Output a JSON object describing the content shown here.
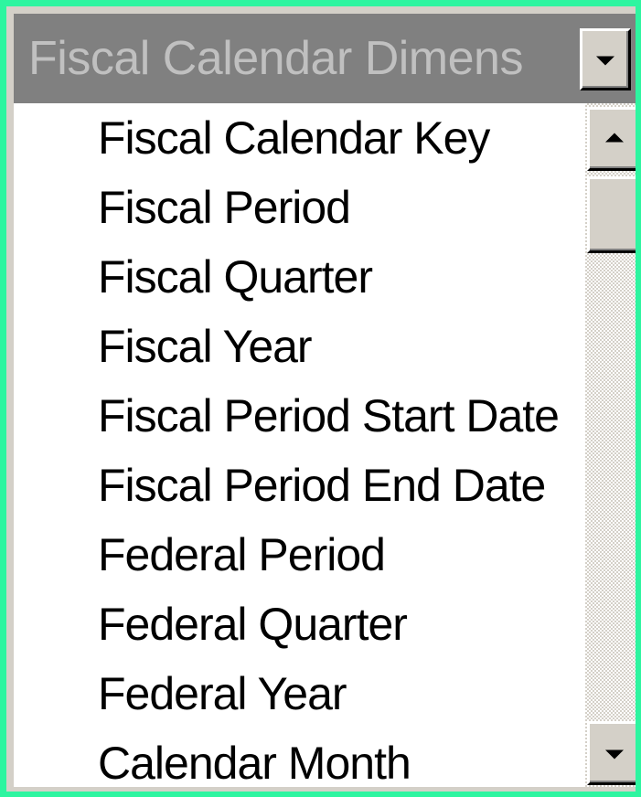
{
  "header": {
    "title": "Fiscal Calendar Dimens"
  },
  "list": {
    "items": [
      "Fiscal Calendar Key",
      "Fiscal Period",
      "Fiscal Quarter",
      "Fiscal Year",
      "Fiscal Period Start Date",
      "Fiscal Period End Date",
      "Federal Period",
      "Federal Quarter",
      "Federal Year",
      "Calendar Month"
    ]
  },
  "icons": {
    "dropdown": "chevron-down-icon",
    "scroll_up": "arrow-up-icon",
    "scroll_down": "arrow-down-icon"
  },
  "colors": {
    "background": "#2df5a0",
    "header_bg": "#808080",
    "header_text": "#c0c0c0",
    "panel": "#d4d0c8",
    "list_bg": "#ffffff"
  }
}
